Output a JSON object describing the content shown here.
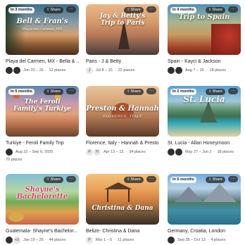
{
  "share_label": "Share",
  "cards": [
    {
      "badge": "In 3 months",
      "art_title": "Bell & Fran's",
      "art_sub": "Playa del Carmen, MX",
      "name": "Playa del Carmen, MX - Bella & ...",
      "dates": "Jun 20 – 26",
      "places": "12 places",
      "avatars": [
        "",
        ""
      ]
    },
    {
      "badge": "",
      "art_title": "Jay & Betty's Trip to Paris",
      "art_sub": "",
      "name": "Paris - J & Betty",
      "dates": "Jul 8 – 15",
      "places": "22 places",
      "avatars": [
        "J"
      ]
    },
    {
      "badge": "In 4 months",
      "art_title": "Trip to Spain",
      "art_sub": "",
      "name": "Spain - Kayci & Jackson",
      "dates": "Aug 7 – 16",
      "places": "18 places",
      "avatars": [
        "",
        ""
      ]
    },
    {
      "badge": "In 5 months",
      "art_title": "The Feroli Family's Turkiye",
      "art_sub": "",
      "name": "Turkiye - Feroli Family Trip",
      "dates": "Aug 22 – Sep 6, 2025",
      "places": "70 places",
      "avatars": [
        ""
      ]
    },
    {
      "badge": "",
      "art_title": "Preston & Hannah",
      "art_sub": "FLORENCE, ITALY",
      "name": "Florence, Italy - Hannah & Preston",
      "dates": "Apr 13 – 13",
      "places": "34 places",
      "avatars": [
        "P",
        "H"
      ]
    },
    {
      "badge": "In 2 months",
      "art_title": "St. Lucia",
      "art_sub": "",
      "name": "St. Lucia - Allan Honeymoon",
      "dates": "May 27 – Jun 2",
      "places": "18 places",
      "avatars": [
        "",
        ""
      ]
    },
    {
      "badge": "",
      "art_title": "Shayne's Bachelorette",
      "art_sub": "",
      "name": "Guatemala- Shayne's Bachelor...",
      "dates": "Jan 19 – 25",
      "places": "44 places",
      "avatars": [
        "",
        "+3"
      ]
    },
    {
      "badge": "",
      "art_title": "Christina & Dana",
      "art_sub": "",
      "name": "Belize- Christina & Dana",
      "dates": "Mar 1 – 5",
      "places": "11 places",
      "avatars": [
        "P"
      ]
    },
    {
      "badge": "In 6 months",
      "art_title": "",
      "art_sub": "",
      "name": "Germany, Croatia, London",
      "dates": "Sep 28 – Oct 13",
      "places": "4 places",
      "avatars": [
        ""
      ]
    }
  ]
}
